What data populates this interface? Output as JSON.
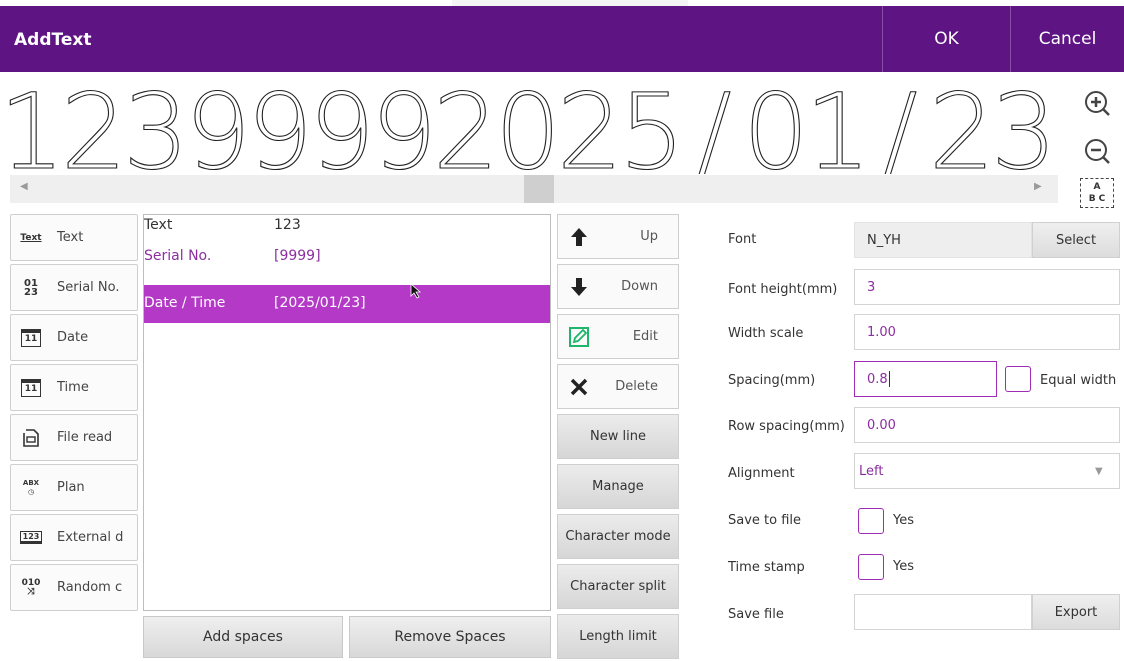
{
  "header": {
    "title": "AddText",
    "ok_label": "OK",
    "cancel_label": "Cancel",
    "color": "#5e1483"
  },
  "preview": {
    "text": "1239999 2025/01/23",
    "glyphs": [
      "1",
      "2",
      "3",
      "9",
      "9",
      "9",
      "9",
      "2",
      "0",
      "2",
      "5",
      "/",
      "0",
      "1",
      "/",
      "2",
      "3"
    ],
    "zoom_in_icon": "zoom-in-icon",
    "zoom_out_icon": "zoom-out-icon"
  },
  "sidebar": {
    "items": [
      {
        "label": "Text",
        "icon": "text-icon"
      },
      {
        "label": "Serial No.",
        "icon": "serial-number-icon"
      },
      {
        "label": "Date",
        "icon": "calendar-icon"
      },
      {
        "label": "Time",
        "icon": "calendar-icon"
      },
      {
        "label": "File read",
        "icon": "file-read-icon"
      },
      {
        "label": "Plan",
        "icon": "plan-clock-icon"
      },
      {
        "label": "External d",
        "icon": "external-data-icon"
      },
      {
        "label": "Random c",
        "icon": "random-icon"
      }
    ],
    "icon_text": {
      "text": "Text",
      "serial_a": "01",
      "serial_b": "23",
      "date": "11",
      "time": "11",
      "plan": "ABX",
      "external": "123",
      "random": "010"
    }
  },
  "list": {
    "rows": [
      {
        "name": "Text",
        "value": "123"
      },
      {
        "name": "Serial No.",
        "value": "[9999]"
      },
      {
        "name": "Date / Time",
        "value": "[2025/01/23]"
      }
    ],
    "selected_index": 2,
    "selected_color": "#b339c6"
  },
  "bottom": {
    "add_spaces": "Add spaces",
    "remove_spaces": "Remove Spaces"
  },
  "actions": {
    "up": "Up",
    "down": "Down",
    "edit": "Edit",
    "delete": "Delete",
    "new_line": "New line",
    "manage": "Manage",
    "character_mode": "Character mode",
    "character_split": "Character split",
    "length_limit": "Length limit"
  },
  "props": {
    "font_label": "Font",
    "font_value": "N_YH",
    "font_select": "Select",
    "height_label": "Font height(mm)",
    "height_value": "3",
    "width_label": "Width scale",
    "width_value": "1.00",
    "spacing_label": "Spacing(mm)",
    "spacing_value": "0.8",
    "equal_width": "Equal width",
    "row_spacing_label": "Row spacing(mm)",
    "row_spacing_value": "0.00",
    "alignment_label": "Alignment",
    "alignment_value": "Left",
    "save_file_label": "Save to file",
    "save_file_yes": "Yes",
    "timestamp_label": "Time stamp",
    "timestamp_yes": "Yes",
    "savefile_label": "Save file",
    "savefile_value": "",
    "export": "Export"
  }
}
